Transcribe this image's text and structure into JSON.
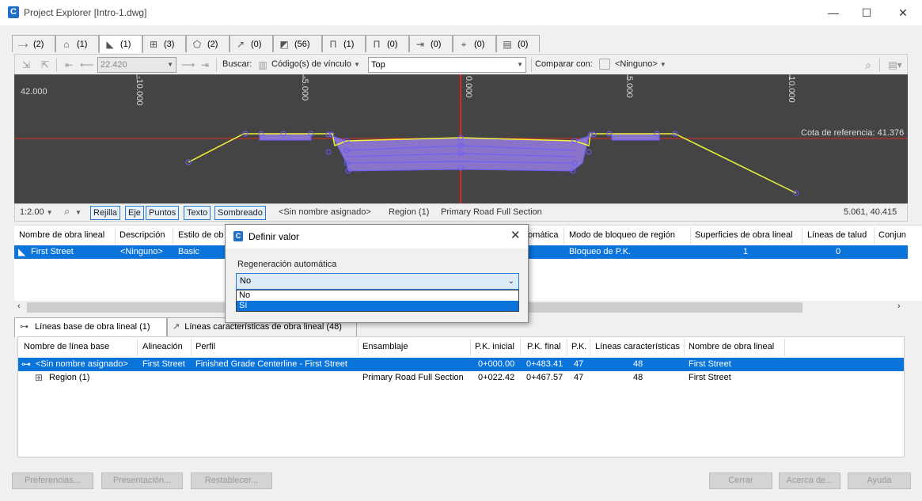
{
  "window": {
    "title": "Project Explorer [Intro-1.dwg]",
    "app_icon_letter": "C",
    "minimize": "—",
    "maximize": "☐",
    "close": "✕"
  },
  "top_tabs": [
    {
      "icon": "⤏",
      "count": "(2)"
    },
    {
      "icon": "⌂",
      "count": "(1)"
    },
    {
      "icon": "◣",
      "count": "(1)"
    },
    {
      "icon": "⊞",
      "count": "(3)"
    },
    {
      "icon": "⬠",
      "count": "(2)"
    },
    {
      "icon": "↗",
      "count": "(0)"
    },
    {
      "icon": "◩",
      "count": "(56)"
    },
    {
      "icon": "Π",
      "count": "(1)"
    },
    {
      "icon": "Π",
      "count": "(0)"
    },
    {
      "icon": "⇥",
      "count": "(0)"
    },
    {
      "icon": "⌖",
      "count": "(0)"
    },
    {
      "icon": "▤",
      "count": "(0)"
    }
  ],
  "toolbar": {
    "station_value": "22.420",
    "search_label": "Buscar:",
    "link_code_label": "Código(s) de vínculo",
    "link_code_value": "Top",
    "compare_label": "Comparar con:",
    "compare_value": "<Ninguno>"
  },
  "viewer": {
    "elevation_label": "42.000",
    "offsets": [
      "-10.000",
      "-5.000",
      "0.000",
      "5.000",
      "10.000"
    ],
    "reference_label": "Cota de referencia: 41.376",
    "colors": {
      "background": "#444444",
      "axis": "#e0271f",
      "surface": "#f2f23a",
      "fill": "#8a74c9",
      "outline": "#6b5cff"
    }
  },
  "viewbar": {
    "scale": "1:2.00",
    "buttons": [
      "Rejilla",
      "Eje",
      "Puntos",
      "Texto",
      "Sombreado"
    ],
    "baseline_name": "<Sin nombre asignado>",
    "region": "Region (1)",
    "assembly": "Primary Road Full Section",
    "coords": "5.061, 40.415"
  },
  "corridor_grid": {
    "headers": [
      "Nombre de obra lineal",
      "Descripción",
      "Estilo de ob",
      "omática",
      "Modo de bloqueo de región",
      "Superficies de obra lineal",
      "Líneas de talud",
      "Conjun"
    ],
    "row": {
      "name": "First Street",
      "description": "<Ninguno>",
      "style": "Basic",
      "lock_mode": "Bloqueo de P.K.",
      "surfaces": "1",
      "slopes": "0"
    }
  },
  "bottom_tabs": [
    {
      "label": "Líneas base de obra lineal (1)"
    },
    {
      "label": "Líneas características de obra lineal (48)"
    }
  ],
  "baseline_grid": {
    "headers": [
      "Nombre de línea base",
      "Alineación",
      "Perfil",
      "Ensamblaje",
      "P.K. inicial",
      "P.K. final",
      "P.K.",
      "Líneas características",
      "Nombre de obra lineal"
    ],
    "rows": [
      {
        "name": "<Sin nombre asignado>",
        "alignment": "First Street",
        "profile": "Finished Grade Centerline - First Street",
        "assembly": "",
        "start": "0+000.00",
        "end": "0+483.41",
        "pk": "47",
        "features": "48",
        "corridor": "First Street"
      },
      {
        "name": "Region (1)",
        "alignment": "",
        "profile": "",
        "assembly": "Primary Road Full Section",
        "start": "0+022.42",
        "end": "0+467.57",
        "pk": "47",
        "features": "48",
        "corridor": "First Street"
      }
    ]
  },
  "bottom_buttons": {
    "preferences": "Preferencias...",
    "presentation": "Presentación...",
    "reset": "Restablecer...",
    "close": "Cerrar",
    "about": "Acerca de...",
    "help": "Ayuda"
  },
  "dialog": {
    "title": "Definir valor",
    "label": "Regeneración automática",
    "selected": "No",
    "options": [
      "No",
      "Sí"
    ]
  }
}
